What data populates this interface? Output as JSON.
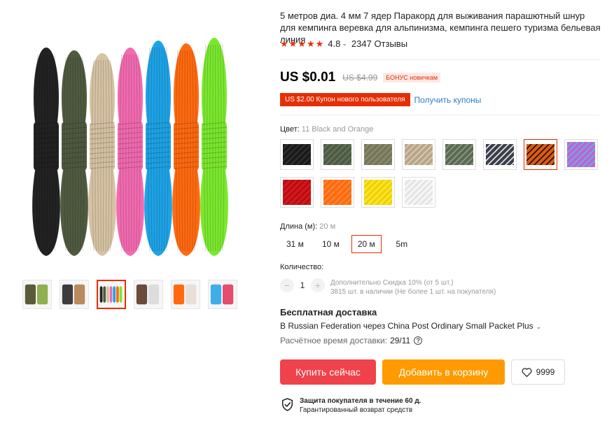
{
  "product": {
    "title": "5 метров диа. 4 мм 7 ядер Паракорд для выживания парашютный шнур для кемпинга веревка для альпинизма, кемпинга пешего туризма бельевая линия",
    "rating": "4.8",
    "reviews": "2347 Отзывы"
  },
  "gallery": {
    "ropes": [
      "#222222",
      "#4f5a40",
      "#d6c3a3",
      "#f26ab0",
      "#1ea3e6",
      "#ff6a10",
      "#7be82e"
    ],
    "thumbs": [
      {
        "name": "thumb-green",
        "colors": [
          "#5b5b3a",
          "#8fb04d"
        ]
      },
      {
        "name": "thumb-mixed",
        "colors": [
          "#3c3c3c",
          "#b98a5c"
        ]
      },
      {
        "name": "thumb-set",
        "colors": [
          "#222",
          "#4f5a40",
          "#d6c3a3",
          "#f26ab0",
          "#1ea3e6",
          "#ff6a10",
          "#7be82e"
        ]
      },
      {
        "name": "thumb-camo",
        "colors": [
          "#6a4b3c",
          "#dddddd"
        ]
      },
      {
        "name": "thumb-orange",
        "colors": [
          "#ff6a10",
          "#e8e0d6"
        ]
      },
      {
        "name": "thumb-blue",
        "colors": [
          "#3daee8",
          "#e44d6d"
        ]
      }
    ]
  },
  "price": {
    "current": "US $0.01",
    "old": "US $4.99",
    "bonus": "БОНУС новичкам",
    "coupon": "US $2.00 Купон нового пользователя",
    "get_coupons": "Получить купоны"
  },
  "color": {
    "label": "Цвет:",
    "selected": "11 Black and Orange",
    "swatches": [
      {
        "fill": "#1a1a1a",
        "accent": "#333"
      },
      {
        "fill": "#4d5a44",
        "accent": "#6a7660"
      },
      {
        "fill": "#76765a",
        "accent": "#8f8f72"
      },
      {
        "fill": "#b8a58a",
        "accent": "#d9cbb4"
      },
      {
        "fill": "#5b6a54",
        "accent": "#8a9a80"
      },
      {
        "fill": "#3a3f4a",
        "accent": "#e0e0e0"
      },
      {
        "fill": "#e2590c",
        "accent": "#1a1a1a"
      },
      {
        "fill": "#c95fd0",
        "accent": "#43c3e8"
      },
      {
        "fill": "#d6151a",
        "accent": "#a10d10"
      },
      {
        "fill": "#ff6a10",
        "accent": "#ff8a3a"
      },
      {
        "fill": "#f0d400",
        "accent": "#ffe84a"
      },
      {
        "fill": "#f4f4f4",
        "accent": "#dcdcdc"
      }
    ]
  },
  "length": {
    "label": "Длина (м):",
    "selected": "20 м",
    "options": [
      "31 м",
      "10 м",
      "20 м",
      "5m"
    ]
  },
  "quantity": {
    "label": "Количество:",
    "value": "1",
    "minus": "−",
    "plus": "+",
    "discount": "Дополнительно Скидка 10% (от 5 шт.)",
    "stock": "3815 шт. в наличии (Не более 1 шт. на покупателя)"
  },
  "shipping": {
    "title": "Бесплатная доставка",
    "route": "В Russian Federation через China Post Ordinary Small Packet Plus",
    "time_label": "Расчётное время доставки:",
    "date": "29/11"
  },
  "actions": {
    "buy": "Купить сейчас",
    "cart": "Добавить в корзину",
    "wishlist": "9999"
  },
  "protection": {
    "title": "Защита покупателя в течение 60 д.",
    "subtitle": "Гарантированный возврат средств"
  }
}
